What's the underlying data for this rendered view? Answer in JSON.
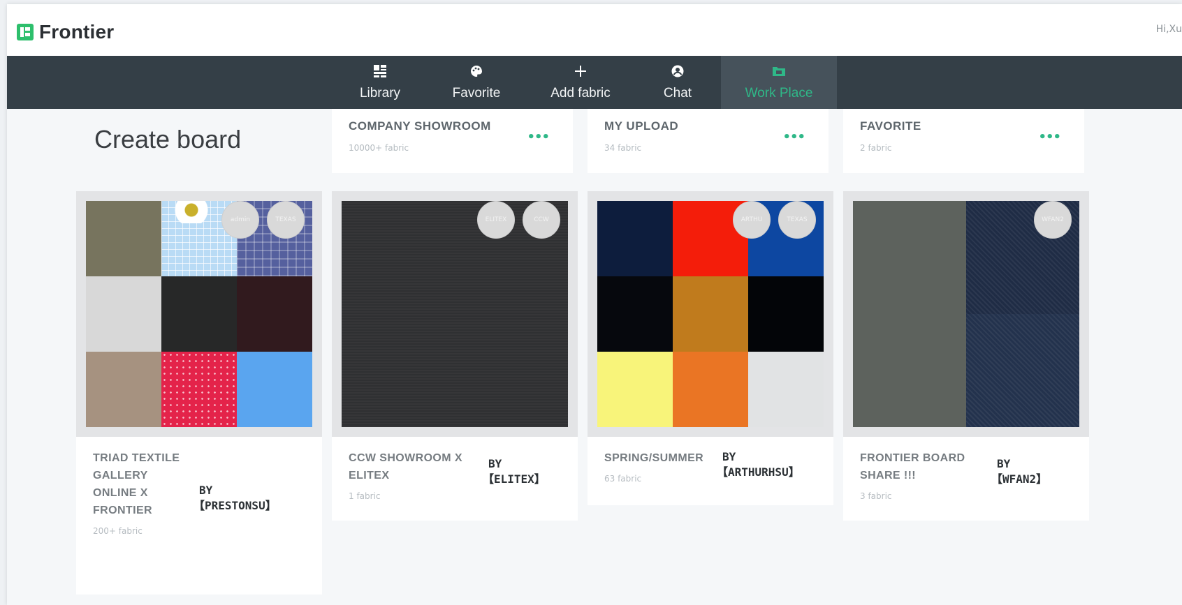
{
  "app": {
    "name": "Frontier",
    "greeting": "Hi,Xu"
  },
  "nav": {
    "items": [
      {
        "label": "Library",
        "icon": "grid-icon"
      },
      {
        "label": "Favorite",
        "icon": "palette-icon"
      },
      {
        "label": "Add fabric",
        "icon": "plus-icon"
      },
      {
        "label": "Chat",
        "icon": "user-circle-icon"
      },
      {
        "label": "Work Place",
        "icon": "folder-icon",
        "active": true
      }
    ]
  },
  "page": {
    "create_label": "Create board"
  },
  "summaries": [
    {
      "title": "COMPANY SHOWROOM",
      "count": "10000+ fabric",
      "more": "•••"
    },
    {
      "title": "MY UPLOAD",
      "count": "34 fabric",
      "more": "•••"
    },
    {
      "title": "FAVORITE",
      "count": "2 fabric",
      "more": "•••"
    }
  ],
  "boards": [
    {
      "title_lines": [
        "TRIAD TEXTILE",
        "GALLERY",
        "ONLINE X",
        "FRONTIER"
      ],
      "by": "BY",
      "owner": "【PRESTONSU】",
      "count": "200+ fabric",
      "avatars": [
        "admin",
        "TEXAS"
      ]
    },
    {
      "title_lines": [
        "CCW SHOWROOM X",
        "ELITEX"
      ],
      "by": "BY",
      "owner": "【ELITEX】",
      "count": "1 fabric",
      "avatars": [
        "ELITEX",
        "CCW"
      ]
    },
    {
      "title_lines": [
        "SPRING/SUMMER"
      ],
      "by": "BY",
      "owner": "【ARTHURHSU】",
      "count": "63 fabric",
      "avatars": [
        "ARTHU",
        "TEXAS"
      ]
    },
    {
      "title_lines": [
        "FRONTIER BOARD",
        "SHARE !!!"
      ],
      "by": "BY",
      "owner": "【WFAN2】",
      "count": "3 fabric",
      "avatars": [
        "WFAN2"
      ]
    }
  ],
  "colors": {
    "nav_bg": "#343f47",
    "accent": "#2fb888",
    "logo": "#2dbf6c"
  }
}
